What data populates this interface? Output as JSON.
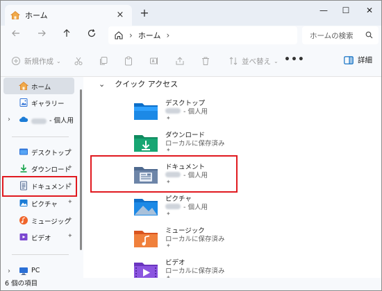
{
  "tab": {
    "title": "ホーム",
    "close_glyph": "×",
    "new_tab_glyph": "+"
  },
  "window_controls": {
    "minimize": "—",
    "maximize": "☐",
    "close": "✕"
  },
  "address": {
    "location": "ホーム",
    "search_placeholder": "ホームの検索"
  },
  "toolbar": {
    "new_label": "新規作成",
    "sort_label": "並べ替え",
    "more_label": "•••",
    "details_label": "詳細"
  },
  "sidebar": {
    "home": "ホーム",
    "gallery": "ギャラリー",
    "onedrive": "- 個人用",
    "desktop": "デスクトップ",
    "downloads": "ダウンロード",
    "documents": "ドキュメント",
    "pictures": "ピクチャ",
    "music": "ミュージック",
    "videos": "ビデオ",
    "pc": "PC",
    "pin_glyph": "📌"
  },
  "content": {
    "section_title": "クイック アクセス",
    "folders": [
      {
        "name": "デスクトップ",
        "sub": "- 個人用",
        "blurred": true,
        "icon": "desktop-folder-icon"
      },
      {
        "name": "ダウンロード",
        "sub": "ローカルに保存済み",
        "blurred": false,
        "icon": "downloads-folder-icon"
      },
      {
        "name": "ドキュメント",
        "sub": "- 個人用",
        "blurred": true,
        "icon": "documents-folder-icon"
      },
      {
        "name": "ピクチャ",
        "sub": "- 個人用",
        "blurred": true,
        "icon": "pictures-folder-icon"
      },
      {
        "name": "ミュージック",
        "sub": "ローカルに保存済み",
        "blurred": false,
        "icon": "music-folder-icon"
      },
      {
        "name": "ビデオ",
        "sub": "ローカルに保存済み",
        "blurred": false,
        "icon": "videos-folder-icon"
      }
    ]
  },
  "status": {
    "item_count": "6 個の項目"
  },
  "colors": {
    "highlight": "#e0191f",
    "accent": "#0067c0",
    "selected_bg": "#dadfe6"
  }
}
